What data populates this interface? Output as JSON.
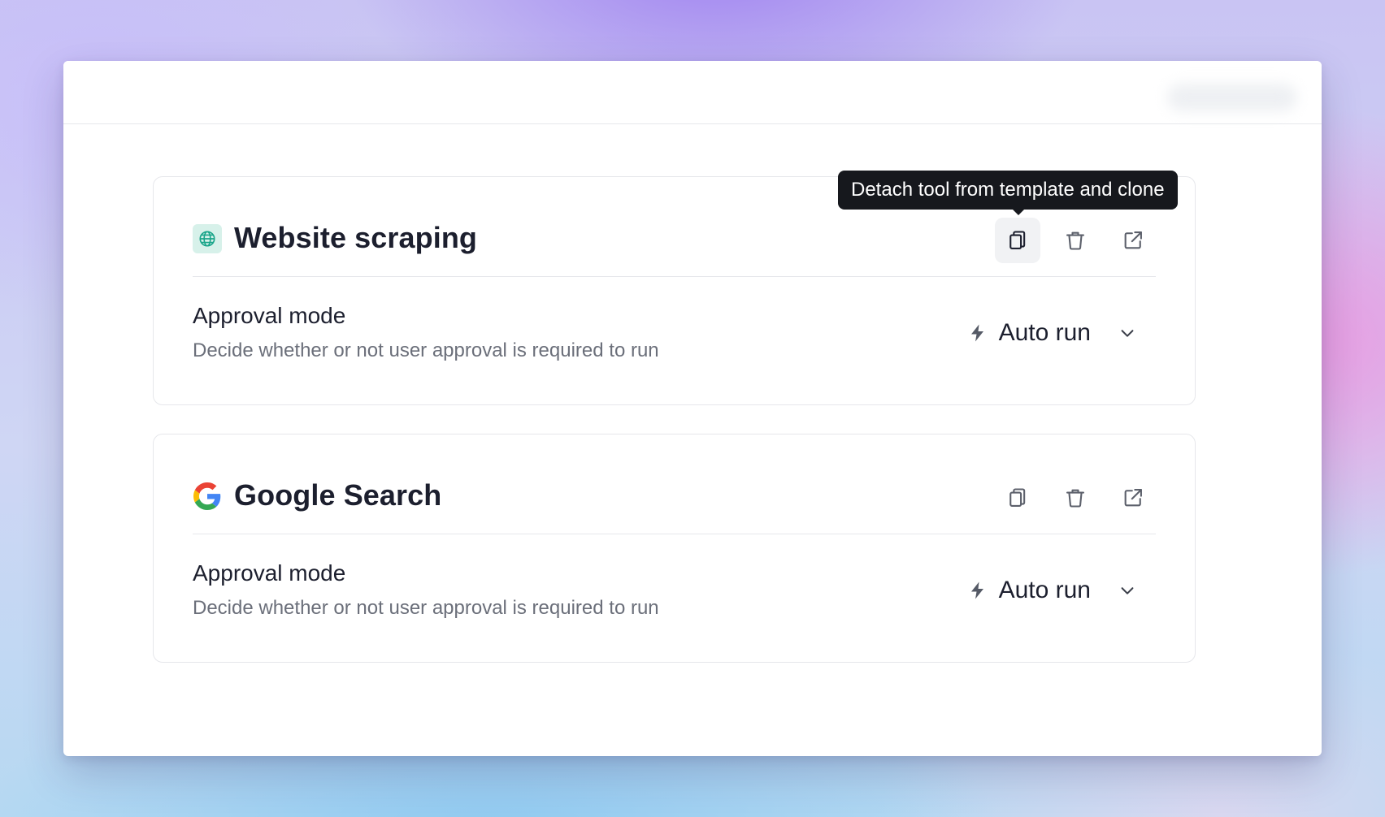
{
  "tooltip": {
    "text": "Detach tool from template and clone"
  },
  "tools": [
    {
      "title": "Website scraping",
      "icon": "globe-icon",
      "approval_label": "Approval mode",
      "approval_desc": "Decide whether or not user approval is required to run",
      "mode": "Auto run"
    },
    {
      "title": "Google Search",
      "icon": "google-logo-icon",
      "approval_label": "Approval mode",
      "approval_desc": "Decide whether or not user approval is required to run",
      "mode": "Auto run"
    }
  ],
  "colors": {
    "title": "#1c1f2e",
    "muted": "#6b6f7a",
    "tooltip_bg": "#16181d",
    "globe_bg": "#d7f1ea"
  }
}
